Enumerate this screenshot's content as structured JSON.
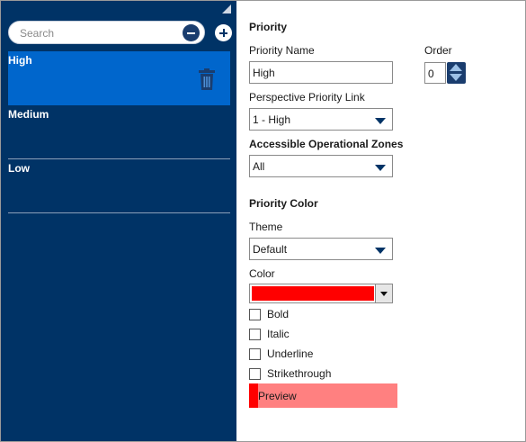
{
  "sidebar": {
    "search_placeholder": "Search",
    "items": [
      {
        "label": "High",
        "selected": true
      },
      {
        "label": "Medium",
        "selected": false
      },
      {
        "label": "Low",
        "selected": false
      }
    ]
  },
  "form": {
    "section_title": "Priority",
    "priority_name_label": "Priority Name",
    "priority_name_value": "High",
    "order_label": "Order",
    "order_value": "0",
    "perspective_link_label": "Perspective Priority Link",
    "perspective_link_value": "1 - High",
    "zones_label": "Accessible Operational Zones",
    "zones_value": "All",
    "color_section_title": "Priority Color",
    "theme_label": "Theme",
    "theme_value": "Default",
    "color_label": "Color",
    "color_value": "#ff0000",
    "checkboxes": [
      {
        "label": "Bold",
        "checked": false
      },
      {
        "label": "Italic",
        "checked": false
      },
      {
        "label": "Underline",
        "checked": false
      },
      {
        "label": "Strikethrough",
        "checked": false
      }
    ],
    "preview_label": "Preview",
    "preview_fill": "#ff8080"
  },
  "colors": {
    "sidebar_bg": "#003366",
    "selected_item": "#0066cc",
    "accent": "#1a3d6e"
  }
}
